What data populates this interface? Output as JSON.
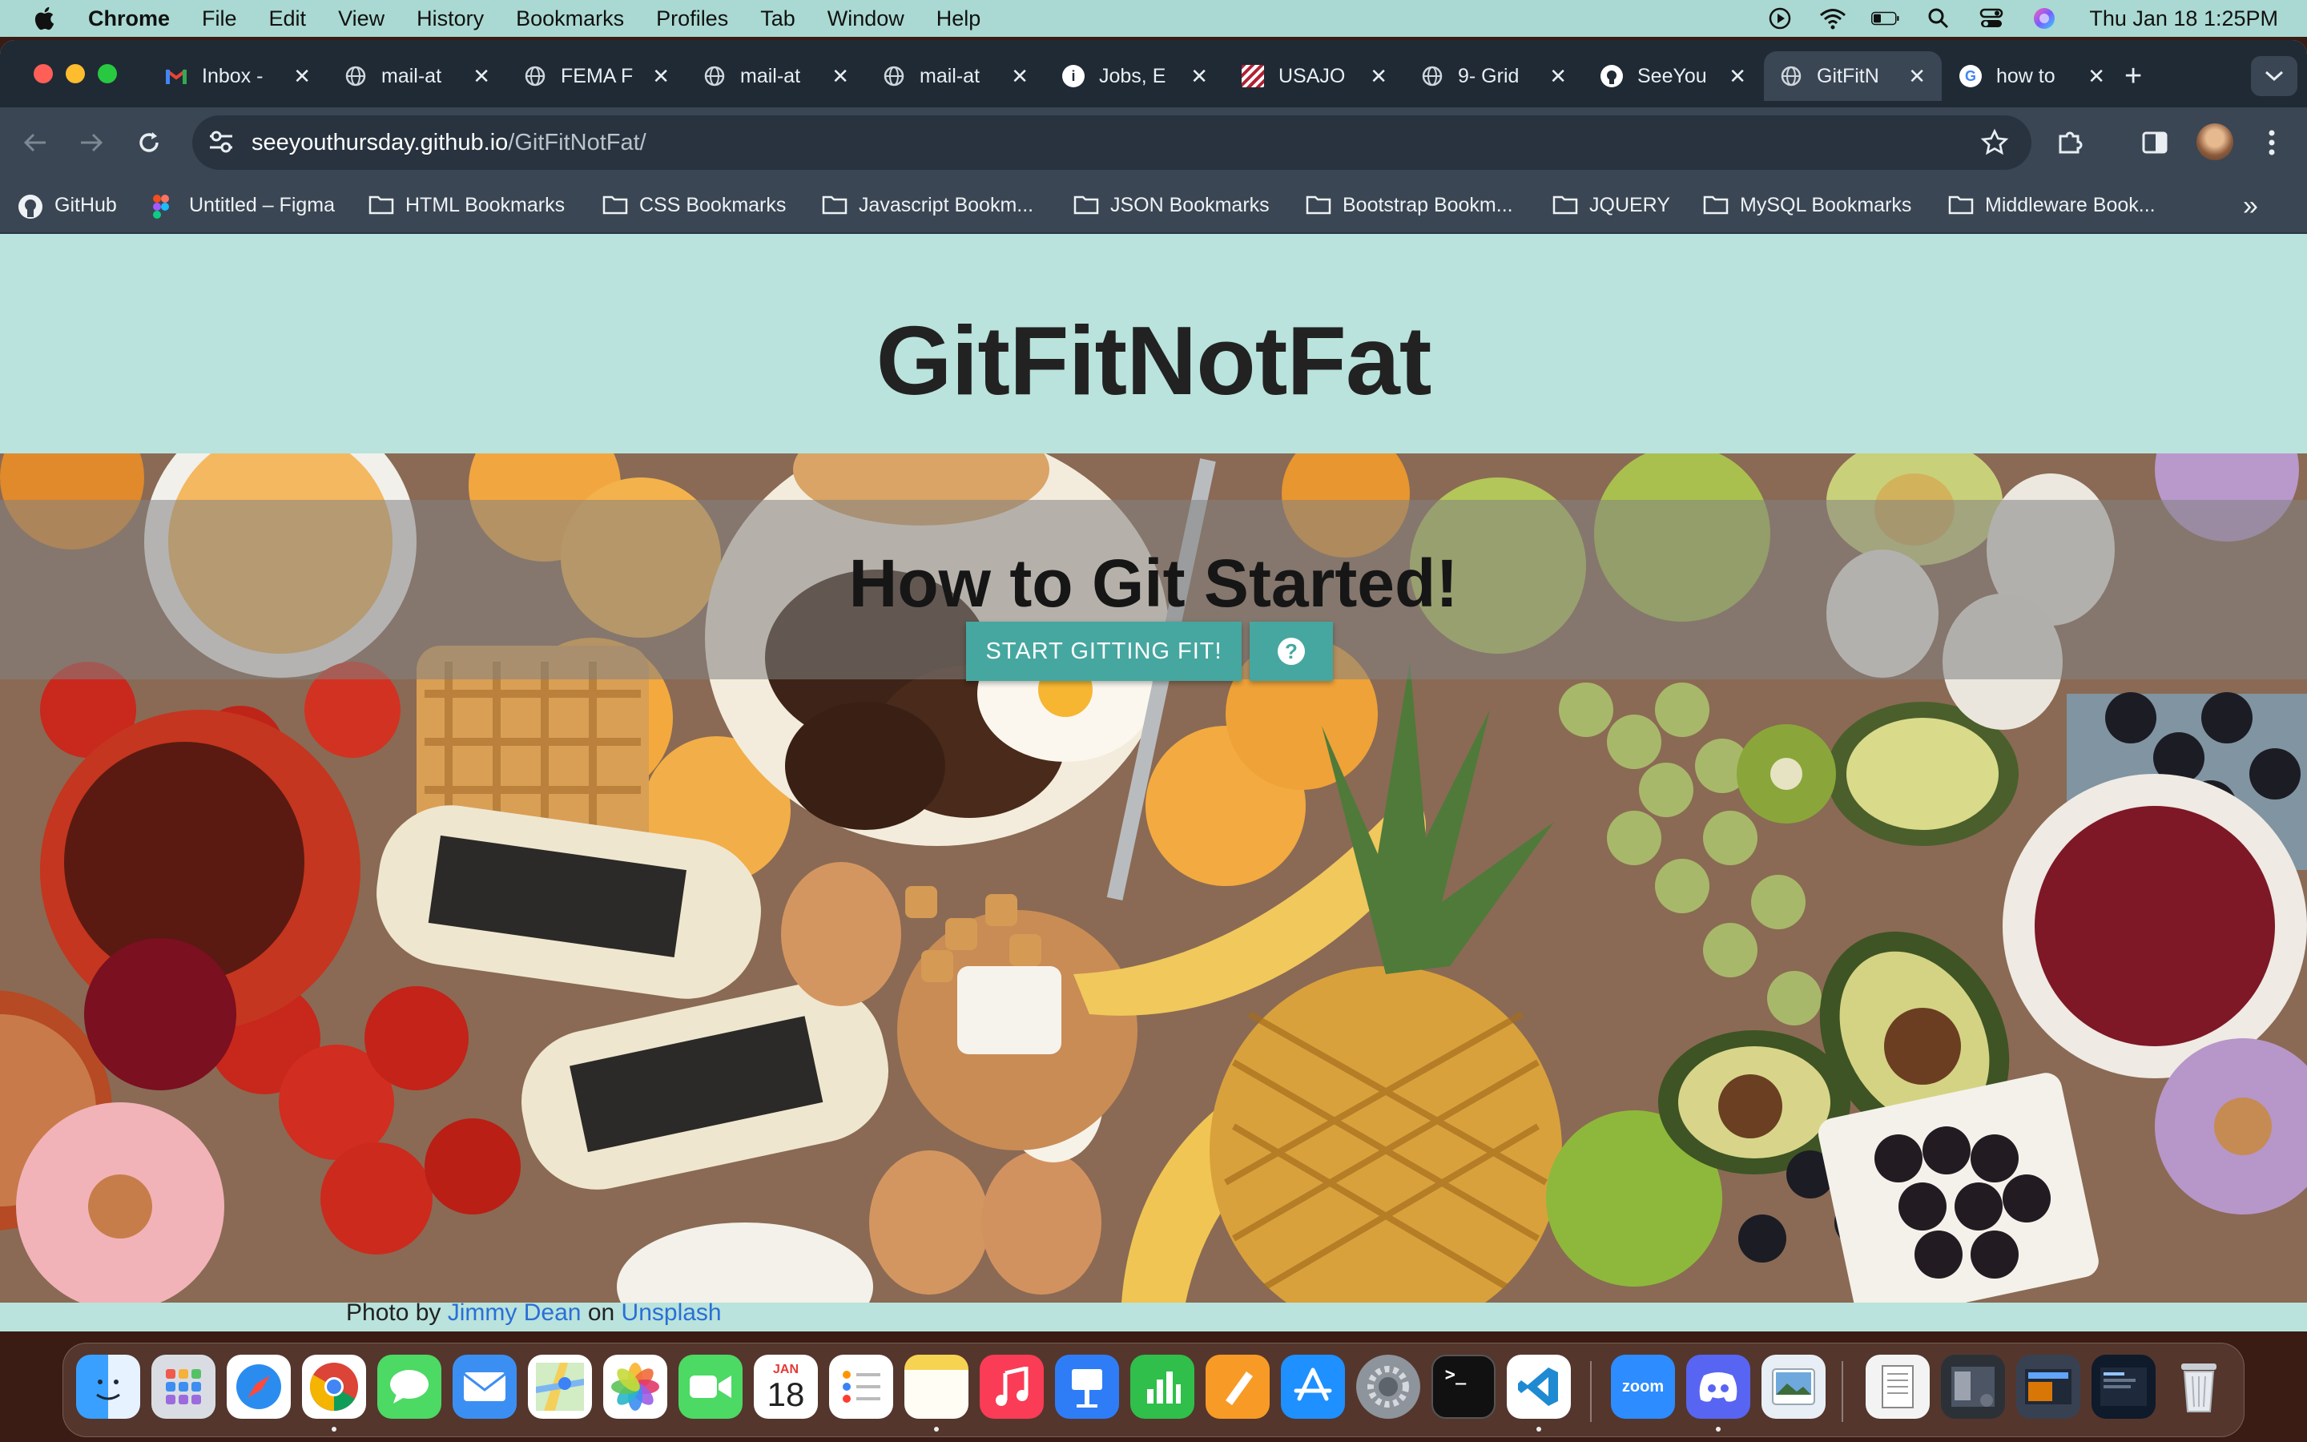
{
  "menubar": {
    "app_name": "Chrome",
    "items": [
      "File",
      "Edit",
      "View",
      "History",
      "Bookmarks",
      "Profiles",
      "Tab",
      "Window",
      "Help"
    ],
    "clock": "Thu Jan 18  1:25PM"
  },
  "tabs": [
    {
      "label": "Inbox -",
      "icon": "gmail-icon"
    },
    {
      "label": "mail-at",
      "icon": "globe-icon"
    },
    {
      "label": "FEMA F",
      "icon": "globe-icon"
    },
    {
      "label": "mail-at",
      "icon": "globe-icon"
    },
    {
      "label": "mail-at",
      "icon": "globe-icon"
    },
    {
      "label": "Jobs, E",
      "icon": "info-icon"
    },
    {
      "label": "USAJO",
      "icon": "flag-icon"
    },
    {
      "label": "9- Grid",
      "icon": "globe-icon"
    },
    {
      "label": "SeeYou",
      "icon": "github-icon"
    },
    {
      "label": "GitFitN",
      "icon": "globe-icon",
      "active": true
    },
    {
      "label": "how to",
      "icon": "google-icon"
    }
  ],
  "address_bar": {
    "domain": "seeyouthursday.github.io",
    "path": "/GitFitNotFat/"
  },
  "bookmarks": [
    {
      "label": "GitHub",
      "icon": "github-icon"
    },
    {
      "label": "Untitled – Figma",
      "icon": "figma-icon"
    },
    {
      "label": "HTML Bookmarks",
      "icon": "folder-icon"
    },
    {
      "label": "CSS Bookmarks",
      "icon": "folder-icon"
    },
    {
      "label": "Javascript Bookm...",
      "icon": "folder-icon"
    },
    {
      "label": "JSON Bookmarks",
      "icon": "folder-icon"
    },
    {
      "label": "Bootstrap Bookm...",
      "icon": "folder-icon"
    },
    {
      "label": "JQUERY",
      "icon": "folder-icon"
    },
    {
      "label": "MySQL Bookmarks",
      "icon": "folder-icon"
    },
    {
      "label": "Middleware Book...",
      "icon": "folder-icon"
    }
  ],
  "page": {
    "title": "GitFitNotFat",
    "hero_heading": "How to Git Started!",
    "cta_label": "START GITTING FIT!",
    "help_label": "?",
    "credit_prefix": "Photo by",
    "credit_author": "Jimmy Dean",
    "credit_middle": "on",
    "credit_source": "Unsplash"
  },
  "dock": {
    "calendar_month": "JAN",
    "calendar_day": "18",
    "zoom_label": "zoom"
  },
  "colors": {
    "page_background": "#b9e3dc",
    "button": "#45a7a0",
    "link": "#2a6fd6",
    "browser_frame": "#3a4654"
  }
}
